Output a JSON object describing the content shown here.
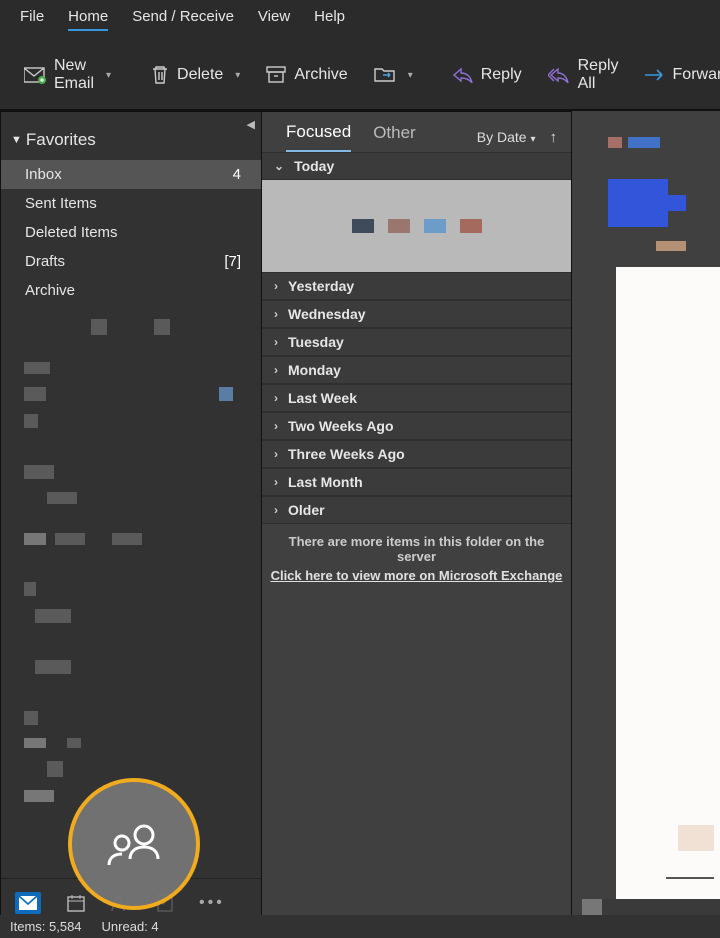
{
  "menu": {
    "file": "File",
    "home": "Home",
    "sendreceive": "Send / Receive",
    "view": "View",
    "help": "Help"
  },
  "toolbar": {
    "newemail": "New Email",
    "delete": "Delete",
    "archive": "Archive",
    "reply": "Reply",
    "replyall": "Reply All",
    "forward": "Forward"
  },
  "nav": {
    "favorites": "Favorites",
    "items": [
      {
        "label": "Inbox",
        "count": "4",
        "brackets": false,
        "selected": true
      },
      {
        "label": "Sent Items",
        "count": "",
        "brackets": false,
        "selected": false
      },
      {
        "label": "Deleted Items",
        "count": "",
        "brackets": false,
        "selected": false
      },
      {
        "label": "Drafts",
        "count": "7",
        "brackets": true,
        "selected": false
      },
      {
        "label": "Archive",
        "count": "",
        "brackets": false,
        "selected": false
      }
    ]
  },
  "messagelist": {
    "tab_focused": "Focused",
    "tab_other": "Other",
    "sort_label": "By Date",
    "groups": {
      "today": "Today",
      "yesterday": "Yesterday",
      "wednesday": "Wednesday",
      "tuesday": "Tuesday",
      "monday": "Monday",
      "lastweek": "Last Week",
      "twoweeks": "Two Weeks Ago",
      "threeweeks": "Three Weeks Ago",
      "lastmonth": "Last Month",
      "older": "Older"
    },
    "more_text": "There are more items in this folder on the server",
    "more_link": "Click here to view more on Microsoft Exchange"
  },
  "status": {
    "items": "Items: 5,584",
    "unread": "Unread: 4"
  }
}
